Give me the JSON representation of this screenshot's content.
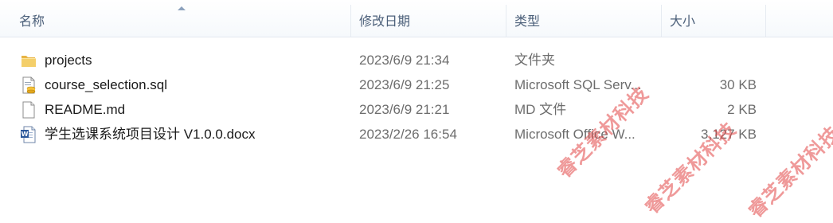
{
  "columns": {
    "name": "名称",
    "date": "修改日期",
    "type": "类型",
    "size": "大小"
  },
  "files": [
    {
      "name": "projects",
      "date": "2023/6/9 21:34",
      "type": "文件夹",
      "size": "",
      "icon": "folder-icon"
    },
    {
      "name": "course_selection.sql",
      "date": "2023/6/9 21:25",
      "type": "Microsoft SQL Serv...",
      "size": "30 KB",
      "icon": "sql-file-icon"
    },
    {
      "name": "README.md",
      "date": "2023/6/9 21:21",
      "type": "MD 文件",
      "size": "2 KB",
      "icon": "blank-file-icon"
    },
    {
      "name": "学生选课系统项目设计 V1.0.0.docx",
      "date": "2023/2/26 16:54",
      "type": "Microsoft Office W...",
      "size": "3,127 KB",
      "icon": "word-doc-icon"
    }
  ],
  "watermarks": [
    "睿芝素材科技",
    "睿芝素材科技",
    "睿芝素材科技"
  ],
  "colors": {
    "header_text": "#4c607a",
    "watermark": "#e14646",
    "folder": "#f2c55c"
  }
}
